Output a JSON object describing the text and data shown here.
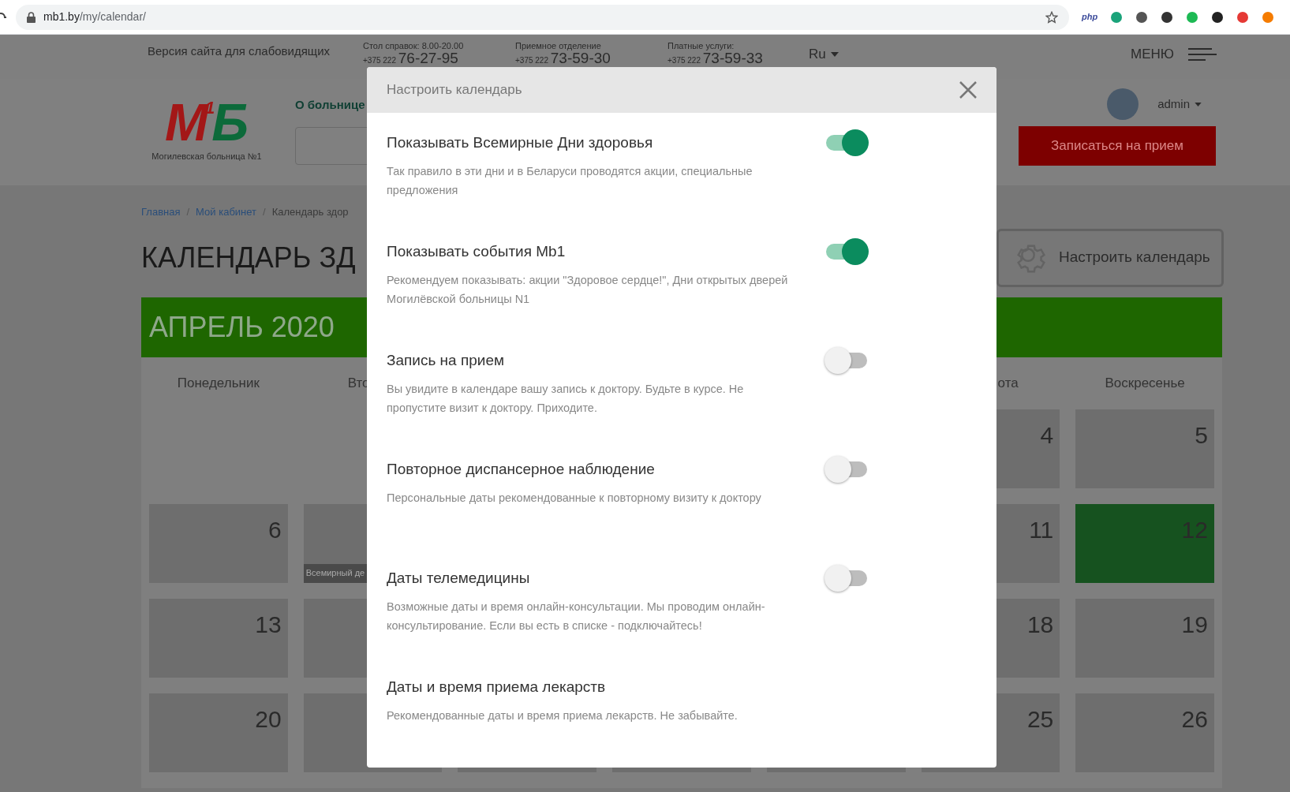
{
  "browser": {
    "url_host": "mb1.by",
    "url_path": "/my/calendar/",
    "extensions": [
      {
        "kind": "text",
        "text": "php"
      },
      {
        "kind": "icon",
        "color": "#1aa37a"
      },
      {
        "kind": "icon",
        "color": "#555555"
      },
      {
        "kind": "icon",
        "color": "#333333"
      },
      {
        "kind": "icon",
        "color": "#1db954"
      },
      {
        "kind": "icon",
        "color": "#222222"
      },
      {
        "kind": "icon",
        "color": "#e53935"
      },
      {
        "kind": "icon",
        "color": "#f57c00"
      }
    ]
  },
  "top_bar": {
    "low_vision_link": "Версия сайта для слабовидящих",
    "contacts": [
      {
        "label": "Стол справок: 8.00-20.00",
        "prefix": "+375 222",
        "number": "76-27-95"
      },
      {
        "label": "Приемное отделение",
        "prefix": "+375 222",
        "number": "73-59-30"
      },
      {
        "label": "Платные услуги:",
        "prefix": "+375 222",
        "number": "73-59-33"
      }
    ],
    "language": "Ru",
    "menu": "МЕНЮ"
  },
  "header": {
    "logo": {
      "letters": [
        {
          "text": "М",
          "color": "#a31717"
        },
        {
          "text": "1",
          "color": "#a31717"
        },
        {
          "text": "Б",
          "color": "#0c6a3a"
        }
      ],
      "caption": "Могилевская больница №1"
    },
    "nav_item": "О больнице",
    "user": "admin",
    "appointment_button": "Записаться на прием"
  },
  "breadcrumbs": [
    {
      "text": "Главная",
      "link": true
    },
    {
      "separator": "/",
      "text": "Мой кабинет",
      "link": true
    },
    {
      "separator": "/",
      "text": "Календарь здор",
      "link": false
    }
  ],
  "page_title": "КАЛЕНДАРЬ ЗД",
  "settings_button": "Настроить календарь",
  "calendar": {
    "month": "АПРЕЛЬ 2020",
    "weekdays_left": [
      "Понедельник",
      "Вто"
    ],
    "weekdays_right": [
      "ота",
      "Воскресенье"
    ],
    "weeks": [
      {
        "right": [
          {
            "day": "4",
            "highlighted": false
          },
          {
            "day": "5",
            "highlighted": false
          }
        ]
      },
      {
        "left": [
          {
            "day": "6",
            "highlighted": false
          },
          {
            "event": "Всемирный де",
            "highlighted": false
          }
        ],
        "right": [
          {
            "day": "11",
            "highlighted": false
          },
          {
            "day": "12",
            "highlighted": true
          }
        ]
      },
      {
        "left": [
          {
            "day": "13",
            "highlighted": false
          },
          {
            "highlighted": false
          }
        ],
        "right": [
          {
            "day": "18",
            "highlighted": false
          },
          {
            "day": "19",
            "highlighted": false
          }
        ]
      },
      {
        "left": [
          {
            "day": "20",
            "highlighted": false
          },
          {
            "highlighted": false
          }
        ],
        "right": [
          {
            "day": "25",
            "highlighted": false
          },
          {
            "day": "26",
            "highlighted": false
          }
        ]
      }
    ]
  },
  "modal": {
    "title": "Настроить календарь",
    "items": [
      {
        "kind": "toggle",
        "title": "Показывать Всемирные Дни здоровья",
        "description": "Так правило в эти дни и в Беларуси проводятся акции, специальные предложения",
        "on": true
      },
      {
        "kind": "toggle",
        "title": "Показывать события Mb1",
        "description": "Рекомендуем показывать: акции \"Здоровое сердце!\", Дни открытых дверей Могилёвской больницы N1",
        "on": true
      },
      {
        "kind": "toggle",
        "title": "Запись на прием",
        "description": "Вы увидите в календаре вашу запись к доктору. Будьте в курсе. Не пропустите визит к доктору. Приходите.",
        "on": false
      },
      {
        "kind": "toggle",
        "title": "Повторное диспансерное наблюдение",
        "description": "Персональные даты рекомендованные к повторному визиту к доктору",
        "on": false
      },
      {
        "kind": "toggle",
        "title": "Даты телемедицины",
        "description": "Возможные даты и время онлайн-консультации. Мы проводим онлайн-консультирование. Если вы есть в списке - подключайтесь!",
        "on": false
      },
      {
        "kind": "plain",
        "title": "Даты и время приема лекарств",
        "description": "Рекомендованные даты и время приема лекарств. Не забывайте."
      }
    ]
  }
}
